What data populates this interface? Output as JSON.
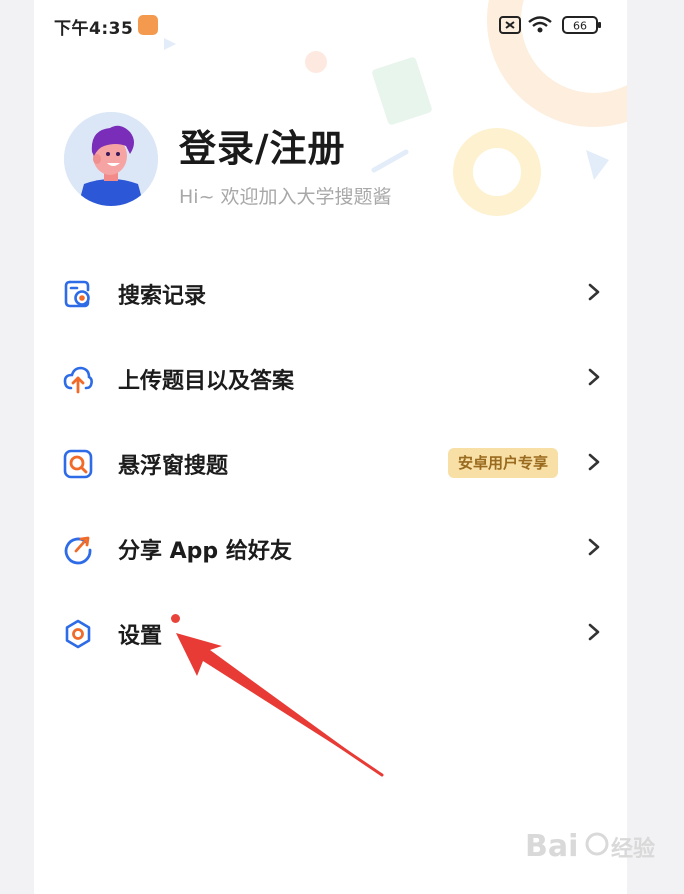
{
  "status_bar": {
    "time": "下午4:35",
    "battery": "66"
  },
  "profile": {
    "title": "登录/注册",
    "subtitle": "Hi~ 欢迎加入大学搜题酱"
  },
  "menu": {
    "items": [
      {
        "label": "搜索记录",
        "icon": "search-history-icon"
      },
      {
        "label": "上传题目以及答案",
        "icon": "upload-cloud-icon"
      },
      {
        "label": "悬浮窗搜题",
        "icon": "floating-search-icon",
        "tag": "安卓用户专享"
      },
      {
        "label": "分享 App 给好友",
        "icon": "share-icon"
      },
      {
        "label": "设置",
        "icon": "settings-icon"
      }
    ]
  },
  "colors": {
    "icon_blue": "#2e6be6",
    "icon_orange": "#f06a2a",
    "tag_bg": "#f7dfa6",
    "tag_text": "#9a6a1e",
    "annotation_red": "#e83b35"
  },
  "watermark": "Baidu经验"
}
